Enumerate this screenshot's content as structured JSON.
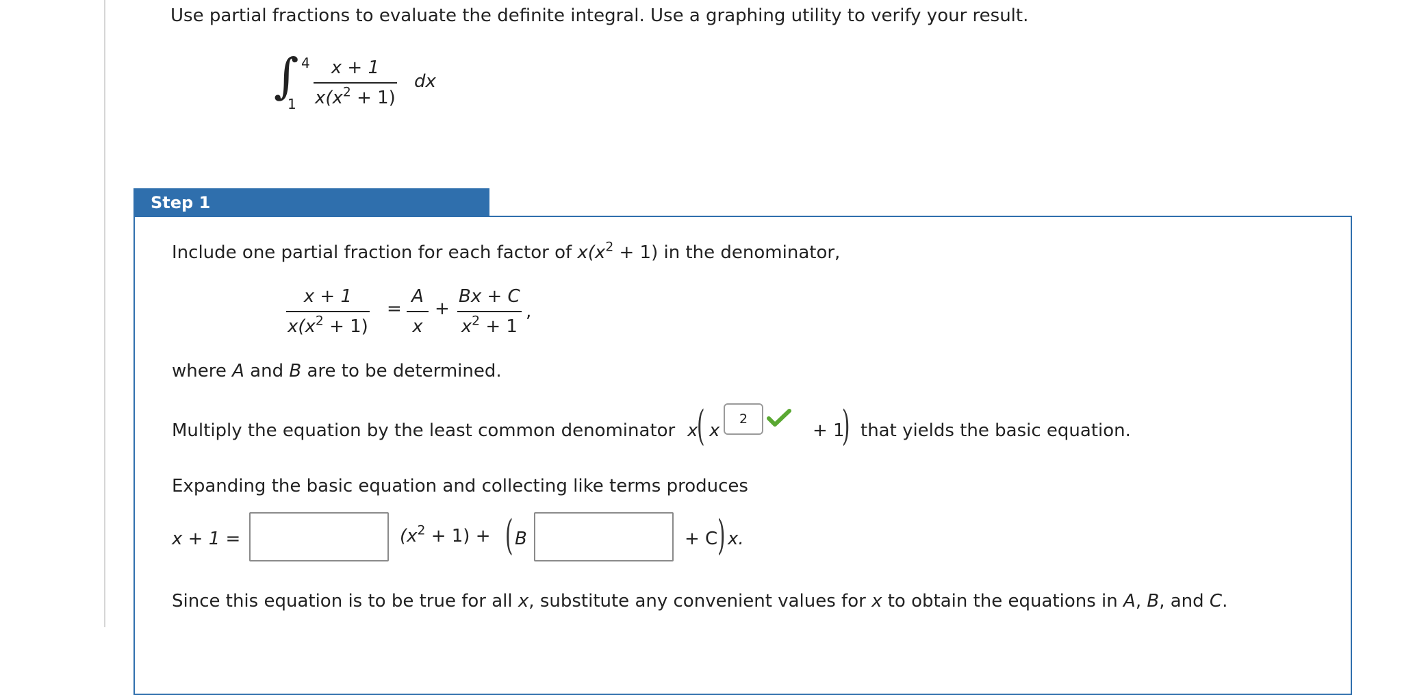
{
  "question": {
    "instruction": "Use partial fractions to evaluate the definite integral. Use a graphing utility to verify your result.",
    "integral": {
      "lower": "1",
      "upper": "4",
      "numerator": "x + 1",
      "den_prefix": "x(x",
      "den_exp": "2",
      "den_suffix": " + 1)",
      "dx": "dx"
    }
  },
  "step": {
    "label": "Step 1",
    "line1": {
      "text": "Include one partial fraction for each factor of ",
      "factor_prefix": "x(x",
      "factor_exp": "2",
      "factor_suffix": " + 1) in the denominator,"
    },
    "equation": {
      "lhs_num": "x + 1",
      "lhs_den_prefix": "x(x",
      "lhs_den_exp": "2",
      "lhs_den_suffix": " + 1)",
      "equals": "=",
      "a_num": "A",
      "a_den": "x",
      "plus": "+",
      "b_num": "Bx + C",
      "b_den_prefix": "x",
      "b_den_exp": "2",
      "b_den_suffix": " + 1",
      "comma": ","
    },
    "where_text": {
      "part1": "where ",
      "a": "A",
      "part2": " and ",
      "b": "B",
      "part3": " are to be determined."
    },
    "lcd_line": {
      "text": "Multiply the equation by the least common denominator ",
      "x1": "x",
      "x2": "x",
      "exponent_answer": "2",
      "status": "correct",
      "plus_one": "+ 1",
      "after": "that yields the basic equation."
    },
    "expand_text": "Expanding the basic equation and collecting like terms produces",
    "basic_equation": {
      "lhs": "x + 1 =",
      "box1_value": "",
      "middle_prefix": "(x",
      "middle_exp": "2",
      "middle_suffix": " + 1) +",
      "b_letter": "B",
      "box2_value": "",
      "plus_c": "+ C",
      "tail": "x."
    },
    "since_text": {
      "part1": "Since this equation is to be true for all ",
      "x1": "x",
      "part2": ", substitute any convenient values for ",
      "x2": "x",
      "part3": " to obtain the equations in ",
      "a": "A",
      "sep1": ", ",
      "b": "B",
      "sep2": ", and ",
      "c": "C",
      "end": "."
    },
    "colors": {
      "header_bg": "#2f6fad",
      "check": "#5aa832"
    }
  }
}
